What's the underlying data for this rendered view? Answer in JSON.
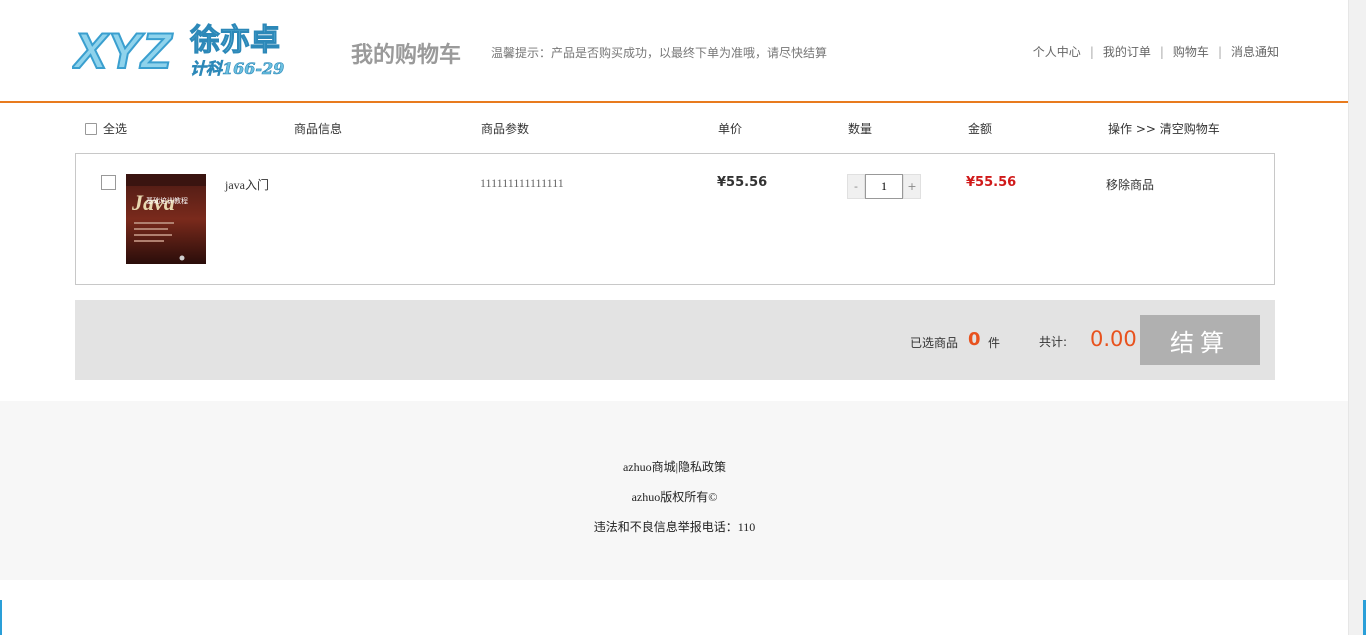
{
  "header": {
    "logo": {
      "text": "XYZ",
      "name": "徐亦卓",
      "sub": "计科166-29"
    },
    "page_title": "我的购物车",
    "tip": "温馨提示：产品是否购买成功，以最终下单为准哦，请尽快结算",
    "nav": [
      "个人中心",
      "我的订单",
      "购物车",
      "消息通知"
    ]
  },
  "columns": {
    "select_all": "全选",
    "info": "商品信息",
    "params": "商品参数",
    "price": "单价",
    "quantity": "数量",
    "amount": "金额",
    "operation": "操作 >> 清空购物车"
  },
  "item": {
    "name": "java入门",
    "params": "111111111111111",
    "price": "¥55.56",
    "quantity": "1",
    "amount": "¥55.56",
    "remove": "移除商品",
    "minus": "-",
    "plus": "+",
    "cover_word": "Java",
    "cover_sub": "基础培训教程"
  },
  "summary": {
    "selected_label": "已选商品",
    "selected_count": "0",
    "selected_unit": "件",
    "total_label": "共计:",
    "total": "0.00",
    "checkout": "结算"
  },
  "footer": {
    "line1": "azhuo商城|隐私政策",
    "line2": "azhuo版权所有©",
    "line3": "违法和不良信息举报电话：110"
  },
  "colors": {
    "accent": "#e87b1e",
    "price_red": "#d01a1a",
    "total_orange": "#e8521e"
  }
}
